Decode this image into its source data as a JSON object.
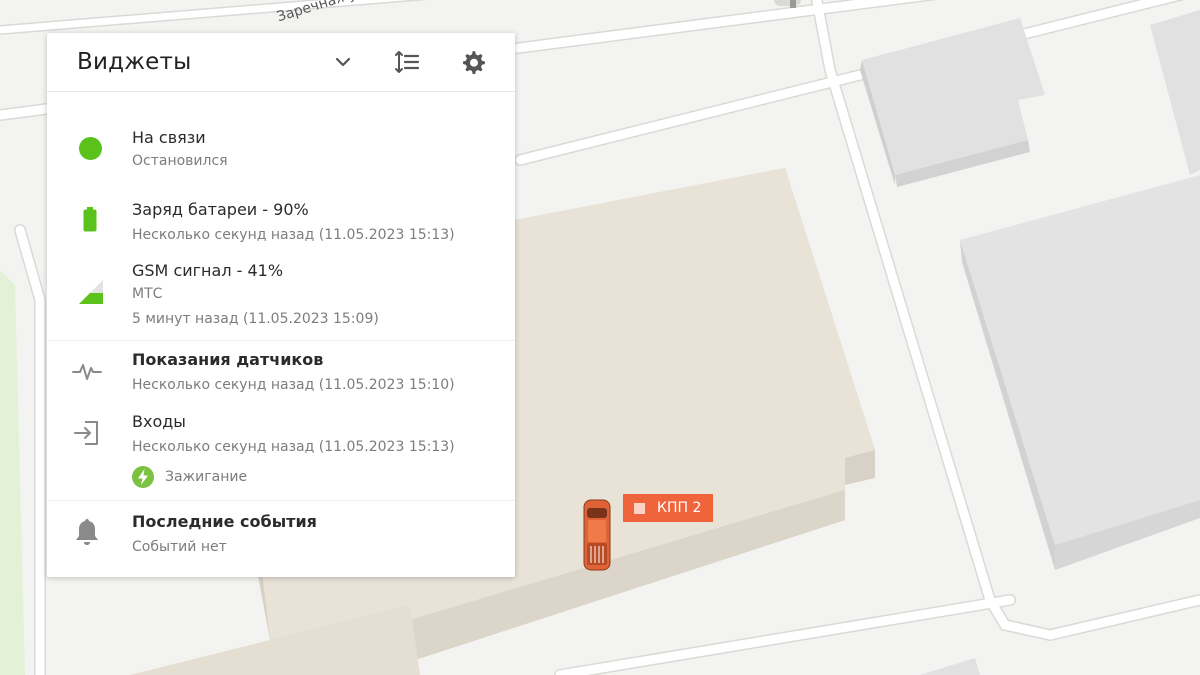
{
  "map": {
    "street_name": "Заречная ул.",
    "marker_label": "КПП 2",
    "marker_color": "#f0643c"
  },
  "widgets": {
    "title": "Виджеты",
    "icons": {
      "collapse": "chevron-down-icon",
      "sort": "sort-order-icon",
      "settings": "gear-icon"
    },
    "connection": {
      "status": "На связи",
      "state": "Остановился",
      "color": "#5ac21a"
    },
    "battery": {
      "title": "Заряд батареи - 90%",
      "updated": "Несколько секунд назад (11.05.2023 15:13)",
      "level": 0.9
    },
    "gsm": {
      "title": "GSM сигнал - 41%",
      "operator": "МТС",
      "updated": "5 минут назад (11.05.2023 15:09)",
      "level": 0.41
    },
    "sensors": {
      "title": "Показания датчиков",
      "updated": "Несколько секунд назад (11.05.2023 15:10)"
    },
    "inputs": {
      "title": "Входы",
      "updated": "Несколько секунд назад (11.05.2023 15:13)",
      "ignition_label": "Зажигание"
    },
    "events": {
      "title": "Последние события",
      "status": "Событий нет"
    }
  }
}
